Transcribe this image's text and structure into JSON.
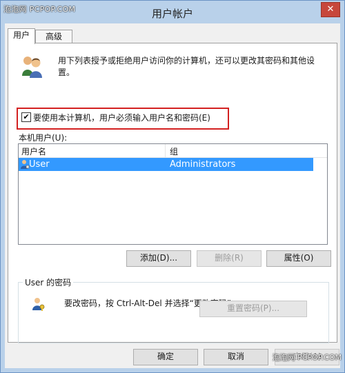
{
  "window": {
    "title": "用户帐户",
    "watermark": "泡泡网 PCPOP.COM",
    "close_glyph": "✕"
  },
  "tabs": [
    {
      "label": "用户"
    },
    {
      "label": "高级"
    }
  ],
  "description": "用下列表授予或拒绝用户访问你的计算机，还可以更改其密码和其他设置。",
  "require_password": {
    "label": "要使用本计算机，用户必须输入用户名和密码(E)",
    "checked": true,
    "check_glyph": "✔"
  },
  "local_users": {
    "label": "本机用户(U):",
    "columns": [
      "用户名",
      "组"
    ],
    "rows": [
      {
        "name": "User",
        "group": "Administrators",
        "selected": true
      }
    ]
  },
  "user_buttons": {
    "add": "添加(D)...",
    "remove": "删除(R)",
    "properties": "属性(O)"
  },
  "password_group": {
    "title": "User 的密码",
    "text": "要改密码，按 Ctrl-Alt-Del 并选择“更改密码”。",
    "reset_button": "重置密码(P)..."
  },
  "dialog_buttons": {
    "ok": "确定",
    "cancel": "取消",
    "apply": "应用(A)"
  },
  "bottom_watermark": "泡泡网 PCPOP.COM",
  "colors": {
    "selection": "#3399ff",
    "highlight_box": "#d32020",
    "title_bar": "#b9d1ea"
  },
  "icons": {
    "users": "users-icon",
    "user_row": "user-icon",
    "password": "key-user-icon",
    "close": "close-icon"
  }
}
